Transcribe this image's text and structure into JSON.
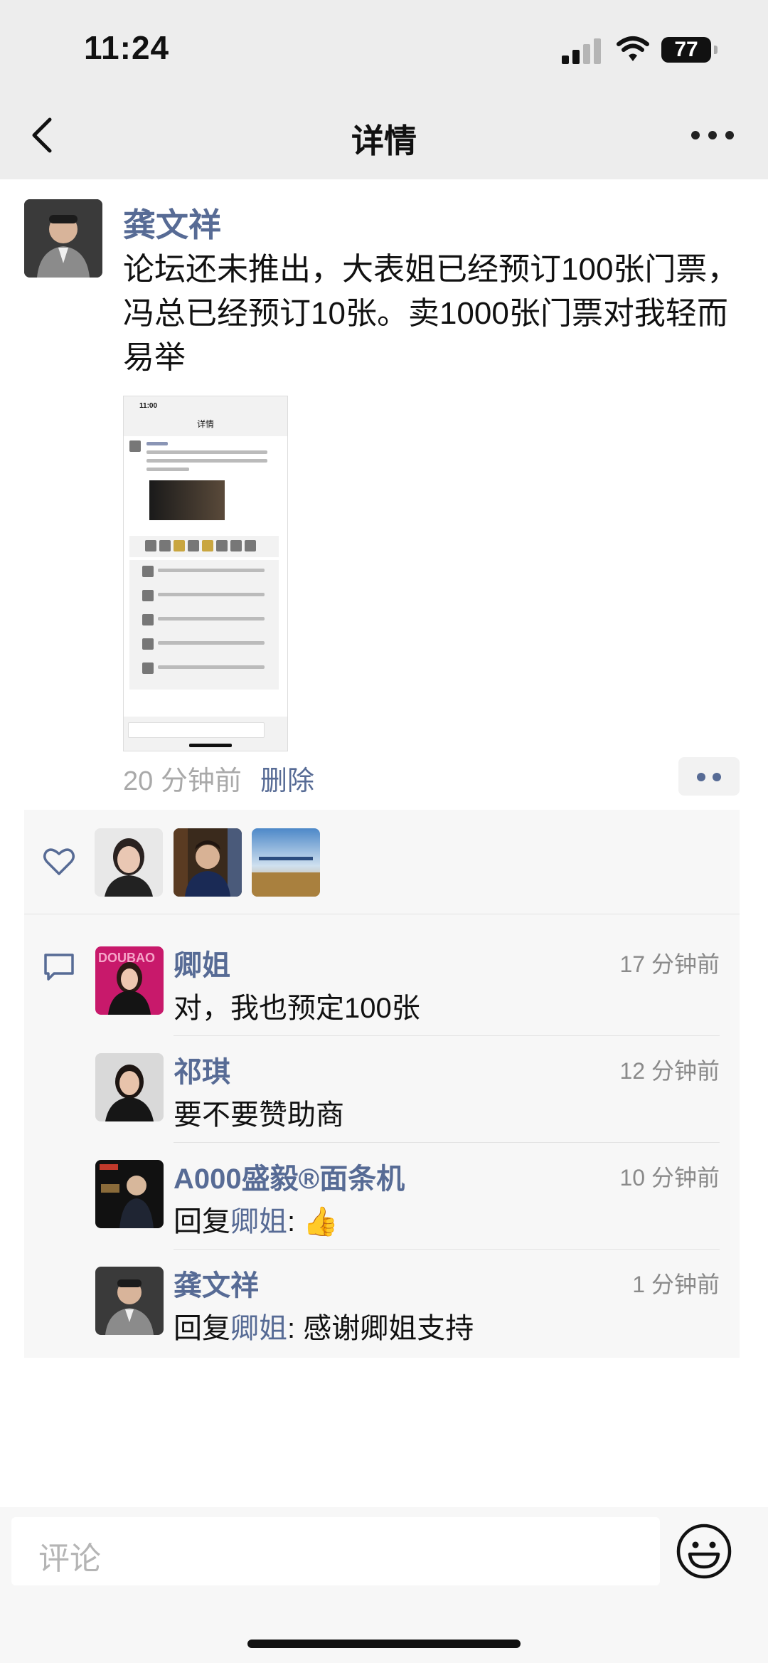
{
  "status": {
    "time": "11:24",
    "battery": "77"
  },
  "nav": {
    "title": "详情"
  },
  "post": {
    "author": "龚文祥",
    "text": "论坛还未推出，大表姐已经预订100张门票，冯总已经预订10张。卖1000张门票对我轻而易举",
    "time": "20 分钟前",
    "delete_label": "删除"
  },
  "comments": [
    {
      "name": "卿姐",
      "time": "17 分钟前",
      "text": "对，我也预定100张"
    },
    {
      "name": "祁琪",
      "time": "12 分钟前",
      "text": "要不要赞助商"
    },
    {
      "name": "A000盛毅®面条机",
      "time": "10 分钟前",
      "reply_prefix": "回复",
      "reply_to": "卿姐",
      "text": ": 👍"
    },
    {
      "name": "龚文祥",
      "time": "1 分钟前",
      "reply_prefix": "回复",
      "reply_to": "卿姐",
      "text": ": 感谢卿姐支持"
    }
  ],
  "input": {
    "placeholder": "评论"
  },
  "colors": {
    "link": "#576b95",
    "bg_top": "#ededed",
    "box": "#f7f7f7"
  },
  "icons": [
    "back-icon",
    "more-icon",
    "heart-icon",
    "comment-icon",
    "emoji-icon"
  ]
}
